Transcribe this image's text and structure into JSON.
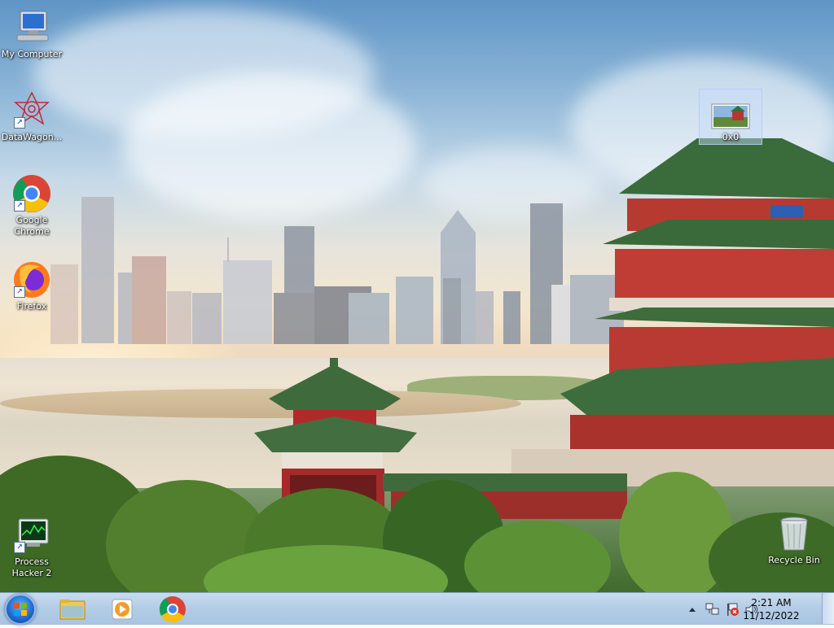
{
  "desktop": {
    "icons": [
      {
        "label": "My Computer"
      },
      {
        "label": "DataWagon..."
      },
      {
        "label": "Google Chrome"
      },
      {
        "label": "Firefox"
      },
      {
        "label": "Process Hacker 2"
      },
      {
        "label": "0x0"
      },
      {
        "label": "Recycle Bin"
      }
    ]
  },
  "taskbar": {
    "pinned": [
      {
        "icon": "windows-explorer-icon"
      },
      {
        "icon": "media-player-icon"
      },
      {
        "icon": "chrome-icon"
      }
    ],
    "tray": {
      "icons": [
        "show-hidden-icons-chevron-icon",
        "network-icon",
        "action-center-icon",
        "volume-icon"
      ]
    },
    "clock": {
      "time": "2:21 AM",
      "date": "11/12/2022"
    }
  },
  "colors": {
    "taskbar": "#b4cde6",
    "start_orb": "#1f66c9"
  }
}
